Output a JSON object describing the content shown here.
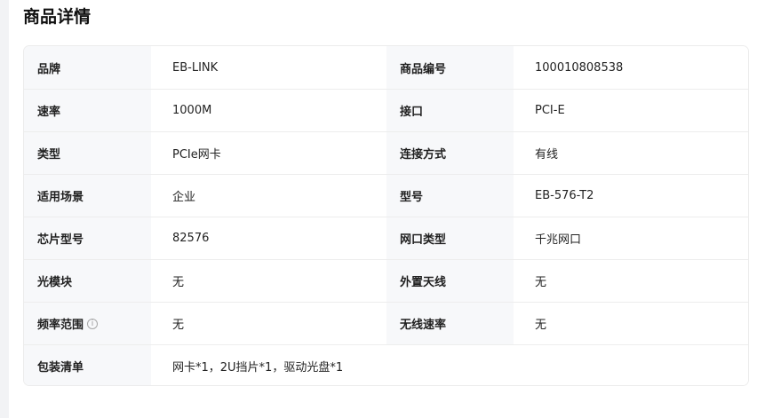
{
  "page": {
    "title": "商品详情"
  },
  "specs": {
    "rows": [
      {
        "l1": "品牌",
        "v1": "EB-LINK",
        "l2": "商品编号",
        "v2": "100010808538"
      },
      {
        "l1": "速率",
        "v1": "1000M",
        "l2": "接口",
        "v2": "PCI-E"
      },
      {
        "l1": "类型",
        "v1": "PCIe网卡",
        "l2": "连接方式",
        "v2": "有线"
      },
      {
        "l1": "适用场景",
        "v1": "企业",
        "l2": "型号",
        "v2": "EB-576-T2"
      },
      {
        "l1": "芯片型号",
        "v1": "82576",
        "l2": "网口类型",
        "v2": "千兆网口"
      },
      {
        "l1": "光模块",
        "v1": "无",
        "l2": "外置天线",
        "v2": "无"
      },
      {
        "l1": "频率范围",
        "v1": "无",
        "l2": "无线速率",
        "v2": "无"
      }
    ],
    "package": {
      "label": "包装清单",
      "value": "网卡*1，2U挡片*1，驱动光盘*1"
    },
    "info_icon_glyph": "i"
  }
}
